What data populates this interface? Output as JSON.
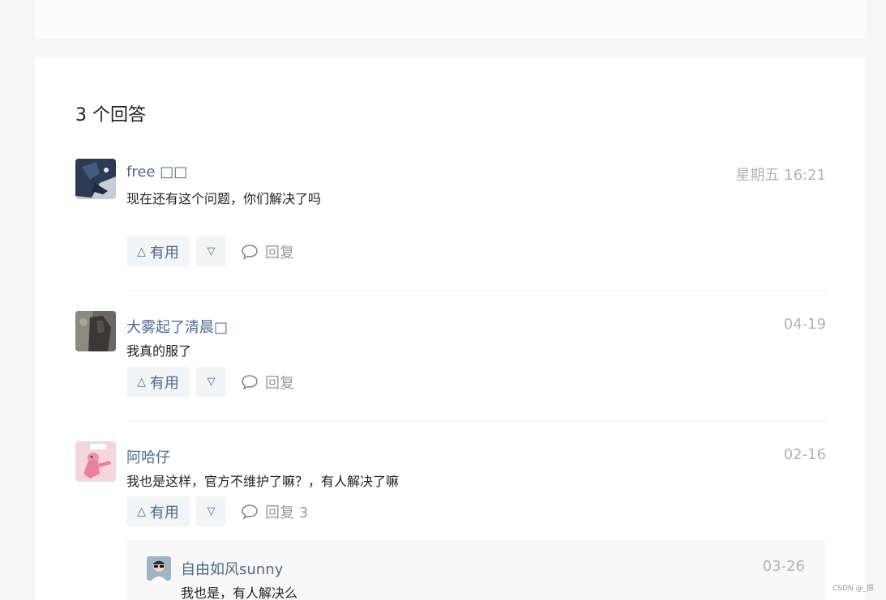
{
  "answers_title": "3 个回答",
  "colors": {
    "link": "#4e6a90",
    "muted": "#b3b3b3",
    "button_bg": "#f3f4f6"
  },
  "answers": [
    {
      "author": "free □□",
      "time": "星期五 16:21",
      "content": "现在还有这个问题，你们解决了吗",
      "avatar_icon": "user-avatar-icon",
      "upvote_label": "有用",
      "reply_label": "回复"
    },
    {
      "author": "大雾起了清晨□",
      "time": "04-19",
      "content": "我真的服了",
      "avatar_icon": "user-avatar-icon",
      "upvote_label": "有用",
      "reply_label": "回复"
    },
    {
      "author": "阿哈仔",
      "time": "02-16",
      "content": "我也是这样，官方不维护了嘛？，有人解决了嘛",
      "avatar_icon": "user-avatar-icon",
      "upvote_label": "有用",
      "reply_label": "回复 3",
      "sub_replies": [
        {
          "author": "自由如风sunny",
          "time": "03-26",
          "content": "我也是，有人解决么"
        }
      ]
    }
  ],
  "watermark": "CSDN @_揽"
}
